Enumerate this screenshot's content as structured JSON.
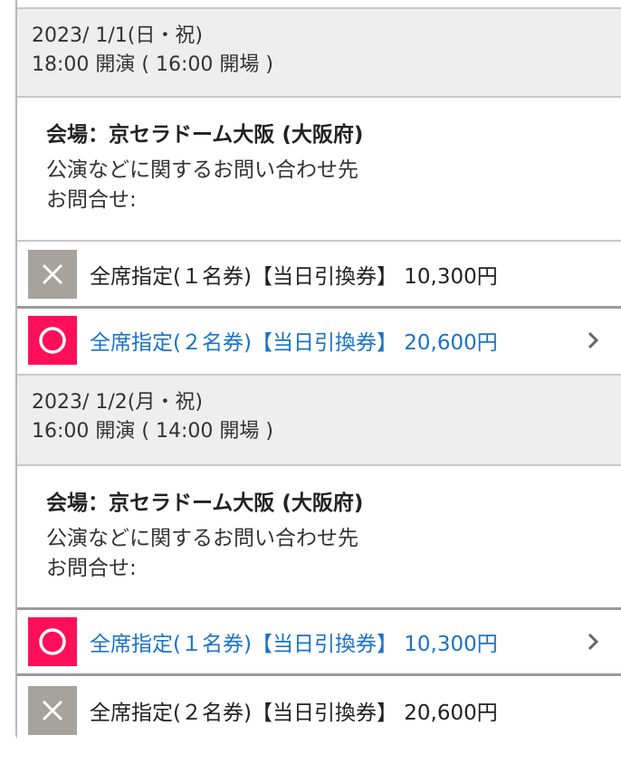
{
  "schedules": [
    {
      "date": "2023/ 1/1(日・祝)",
      "time": "18:00 開演 ( 16:00 開場 )",
      "venue": "会場：京セラドーム大阪 (大阪府)",
      "inquiry_title": "公演などに関するお問い合わせ先",
      "inquiry_value": "お問合せ:",
      "tickets": [
        {
          "label": "全席指定(１名券)【当日引換券】 10,300円",
          "status": "sold-out"
        },
        {
          "label": "全席指定(２名券)【当日引換券】 20,600円",
          "status": "available"
        }
      ]
    },
    {
      "date": "2023/ 1/2(月・祝)",
      "time": "16:00 開演 ( 14:00 開場 )",
      "venue": "会場：京セラドーム大阪 (大阪府)",
      "inquiry_title": "公演などに関するお問い合わせ先",
      "inquiry_value": "お問合せ:",
      "tickets": [
        {
          "label": "全席指定(１名券)【当日引換券】 10,300円",
          "status": "available"
        },
        {
          "label": "全席指定(２名券)【当日引換券】 20,600円",
          "status": "sold-out"
        }
      ]
    }
  ],
  "icons": {
    "sold_out": "cross-icon",
    "available": "circle-icon",
    "more": "chevron-right-icon"
  },
  "colors": {
    "sold_out_badge": "#a6a29c",
    "available_badge": "#ff0f5a",
    "available_text": "#1a73c8",
    "header_bg": "#eeeeee"
  }
}
